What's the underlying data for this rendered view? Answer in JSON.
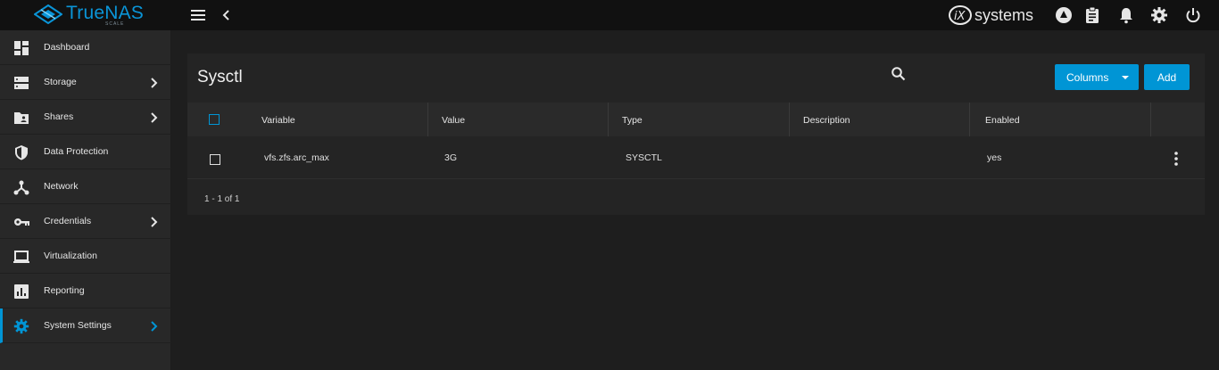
{
  "topbar": {
    "brand_name": "TrueNAS",
    "brand_sub": "SCALE",
    "vendor_name": "systems",
    "icons": [
      "menu-icon",
      "chevron-left-icon",
      "truecommand-icon",
      "clipboard-icon",
      "bell-icon",
      "gear-icon",
      "power-icon"
    ]
  },
  "sidebar": {
    "items": [
      {
        "label": "Dashboard",
        "icon": "dashboard-icon",
        "has_chevron": false
      },
      {
        "label": "Storage",
        "icon": "storage-icon",
        "has_chevron": true
      },
      {
        "label": "Shares",
        "icon": "folder-share-icon",
        "has_chevron": true
      },
      {
        "label": "Data Protection",
        "icon": "shield-icon",
        "has_chevron": false
      },
      {
        "label": "Network",
        "icon": "network-icon",
        "has_chevron": false
      },
      {
        "label": "Credentials",
        "icon": "key-icon",
        "has_chevron": true
      },
      {
        "label": "Virtualization",
        "icon": "laptop-icon",
        "has_chevron": false
      },
      {
        "label": "Reporting",
        "icon": "chart-icon",
        "has_chevron": false
      },
      {
        "label": "System Settings",
        "icon": "gear-icon",
        "has_chevron": true,
        "active": true
      }
    ]
  },
  "card": {
    "title": "Sysctl",
    "columns_button": "Columns",
    "add_button": "Add",
    "headers": [
      "Variable",
      "Value",
      "Type",
      "Description",
      "Enabled"
    ],
    "rows": [
      {
        "variable": "vfs.zfs.arc_max",
        "value": "3G",
        "type": "SYSCTL",
        "description": "",
        "enabled": "yes"
      }
    ],
    "pagination": "1 - 1 of 1"
  },
  "colors": {
    "accent": "#0095d5",
    "topbar_bg": "#111111",
    "sidebar_bg": "#282828",
    "page_bg": "#1e1e1e",
    "card_bg": "#242424"
  }
}
